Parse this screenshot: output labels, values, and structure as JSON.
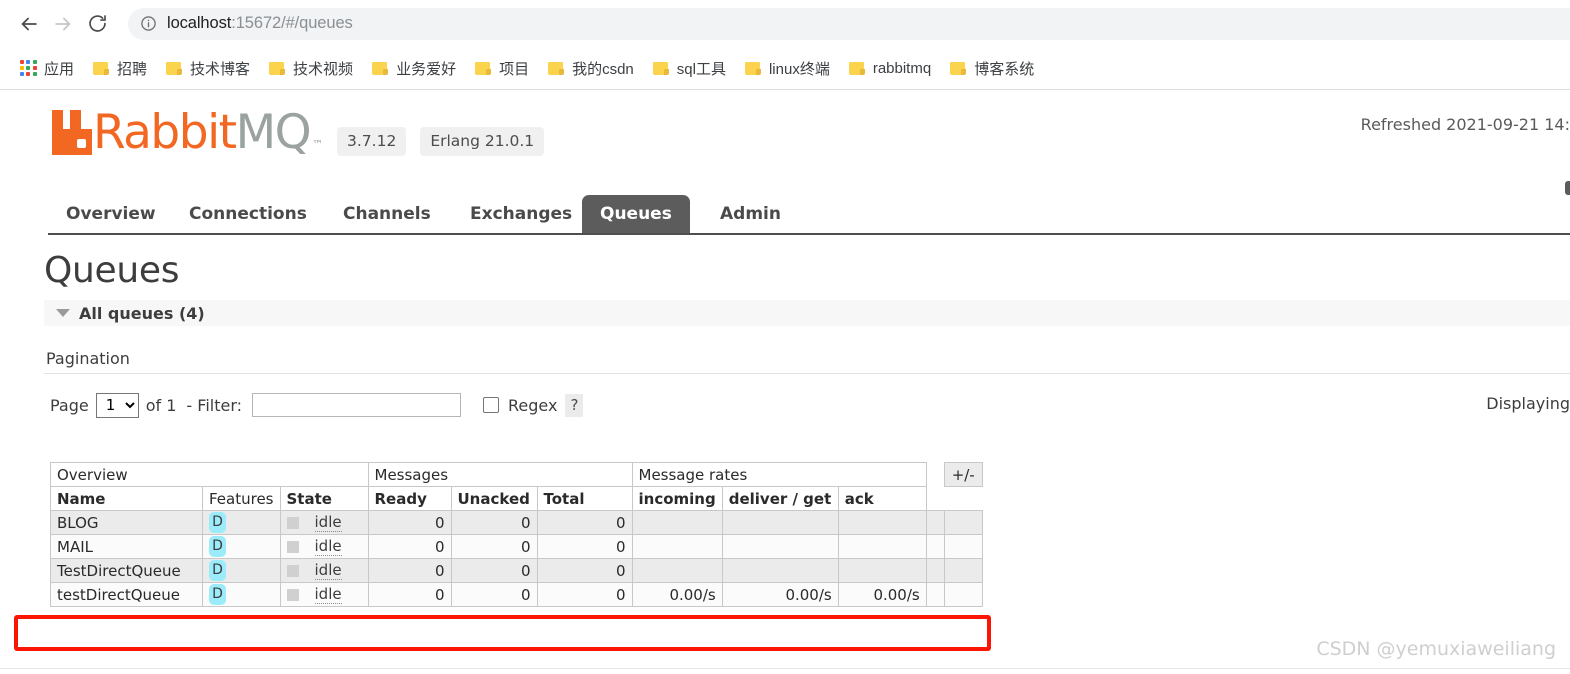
{
  "browser": {
    "back_icon": "arrow-left-icon",
    "forward_icon": "arrow-right-icon",
    "reload_icon": "reload-icon",
    "site_info_icon": "info-circle-icon",
    "url_host": "localhost",
    "url_rest": ":15672/#/queues",
    "bookmarks": [
      {
        "icon": "apps-grid-icon",
        "label": "应用"
      },
      {
        "icon": "folder-icon",
        "label": "招聘"
      },
      {
        "icon": "folder-icon",
        "label": "技术博客"
      },
      {
        "icon": "folder-icon",
        "label": "技术视频"
      },
      {
        "icon": "folder-icon",
        "label": "业务爱好"
      },
      {
        "icon": "folder-icon",
        "label": "项目"
      },
      {
        "icon": "folder-icon",
        "label": "我的csdn"
      },
      {
        "icon": "folder-icon",
        "label": "sql工具"
      },
      {
        "icon": "folder-icon",
        "label": "linux终端"
      },
      {
        "icon": "folder-icon",
        "label": "rabbitmq"
      },
      {
        "icon": "folder-icon",
        "label": "博客系统"
      }
    ]
  },
  "app": {
    "logo_rabbit": "Rabbit",
    "logo_mq": "MQ",
    "logo_tm": "™",
    "version": "3.7.12",
    "erlang": "Erlang 21.0.1",
    "refreshed": "Refreshed 2021-09-21 14:",
    "tabs": [
      {
        "label": "Overview",
        "active": false
      },
      {
        "label": "Connections",
        "active": false
      },
      {
        "label": "Channels",
        "active": false
      },
      {
        "label": "Exchanges",
        "active": false
      },
      {
        "label": "Queues",
        "active": true
      },
      {
        "label": "Admin",
        "active": false
      }
    ]
  },
  "main": {
    "title": "Queues",
    "all_queues": "All queues (4)",
    "pagination_label": "Pagination",
    "page_word": "Page",
    "page_value": "1",
    "of_text": "of 1",
    "filter_label": "- Filter:",
    "filter_value": "",
    "filter_placeholder": "",
    "regex_label": "Regex",
    "help_mark": "?",
    "displaying": "Displaying"
  },
  "table": {
    "group_headers": {
      "overview": "Overview",
      "messages": "Messages",
      "message_rates": "Message rates",
      "plusminus": "+/-"
    },
    "columns": [
      "Name",
      "Features",
      "State",
      "Ready",
      "Unacked",
      "Total",
      "incoming",
      "deliver / get",
      "ack"
    ],
    "rows": [
      {
        "name": "BLOG",
        "features": "D",
        "state": "idle",
        "ready": "0",
        "unacked": "0",
        "total": "0",
        "incoming": "",
        "deliver_get": "",
        "ack": "",
        "highlighted": false
      },
      {
        "name": "MAIL",
        "features": "D",
        "state": "idle",
        "ready": "0",
        "unacked": "0",
        "total": "0",
        "incoming": "",
        "deliver_get": "",
        "ack": "",
        "highlighted": false
      },
      {
        "name": "TestDirectQueue",
        "features": "D",
        "state": "idle",
        "ready": "0",
        "unacked": "0",
        "total": "0",
        "incoming": "",
        "deliver_get": "",
        "ack": "",
        "highlighted": false
      },
      {
        "name": "testDirectQueue",
        "features": "D",
        "state": "idle",
        "ready": "0",
        "unacked": "0",
        "total": "0",
        "incoming": "0.00/s",
        "deliver_get": "0.00/s",
        "ack": "0.00/s",
        "highlighted": true
      }
    ]
  },
  "watermark": "CSDN @yemuxiaweiliang",
  "colors": {
    "brand_orange": "#f26722",
    "logo_gray": "#9aa3a0",
    "active_tab_bg": "#5c5c5c",
    "badge_cyan": "#9bebfb",
    "highlight_red": "#fc1505",
    "folder_yellow": "#fbd34d"
  }
}
